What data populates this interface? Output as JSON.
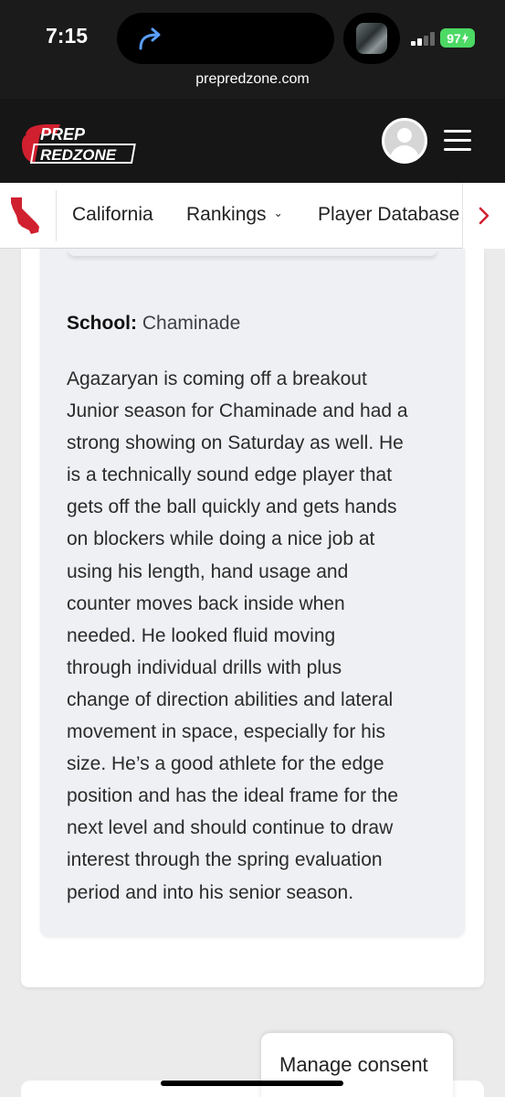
{
  "status_bar": {
    "time": "7:15",
    "battery": "97",
    "url": "prepredzone.com"
  },
  "header": {
    "logo_line1": "PREP",
    "logo_line2": "REDZONE",
    "brand_color": "#d0202f"
  },
  "nav": {
    "state_icon": "california-state-icon",
    "items": [
      {
        "label": "California"
      },
      {
        "label": "Rankings"
      },
      {
        "label": "Player Database"
      }
    ]
  },
  "profile": {
    "school_label": "School:",
    "school_value": "Chaminade",
    "bio_lines": [
      "Agazaryan is coming off a breakout",
      "Junior season for Chaminade and had a",
      "strong showing on Saturday as well. He",
      "is a technically sound edge player that",
      "gets off the ball quickly and gets hands",
      "on blockers while doing a nice job at",
      "using his length, hand usage and",
      "counter moves back inside when",
      "needed. He looked fluid moving",
      "through individual drills with plus",
      "change of direction abilities and lateral",
      "movement in space, especially for his",
      "size. He’s a good athlete for the edge",
      "position and has the ideal frame for the",
      "next level and should continue to draw",
      "interest through the spring evaluation",
      "period and into his senior season."
    ]
  },
  "consent": {
    "label": "Manage consent"
  }
}
